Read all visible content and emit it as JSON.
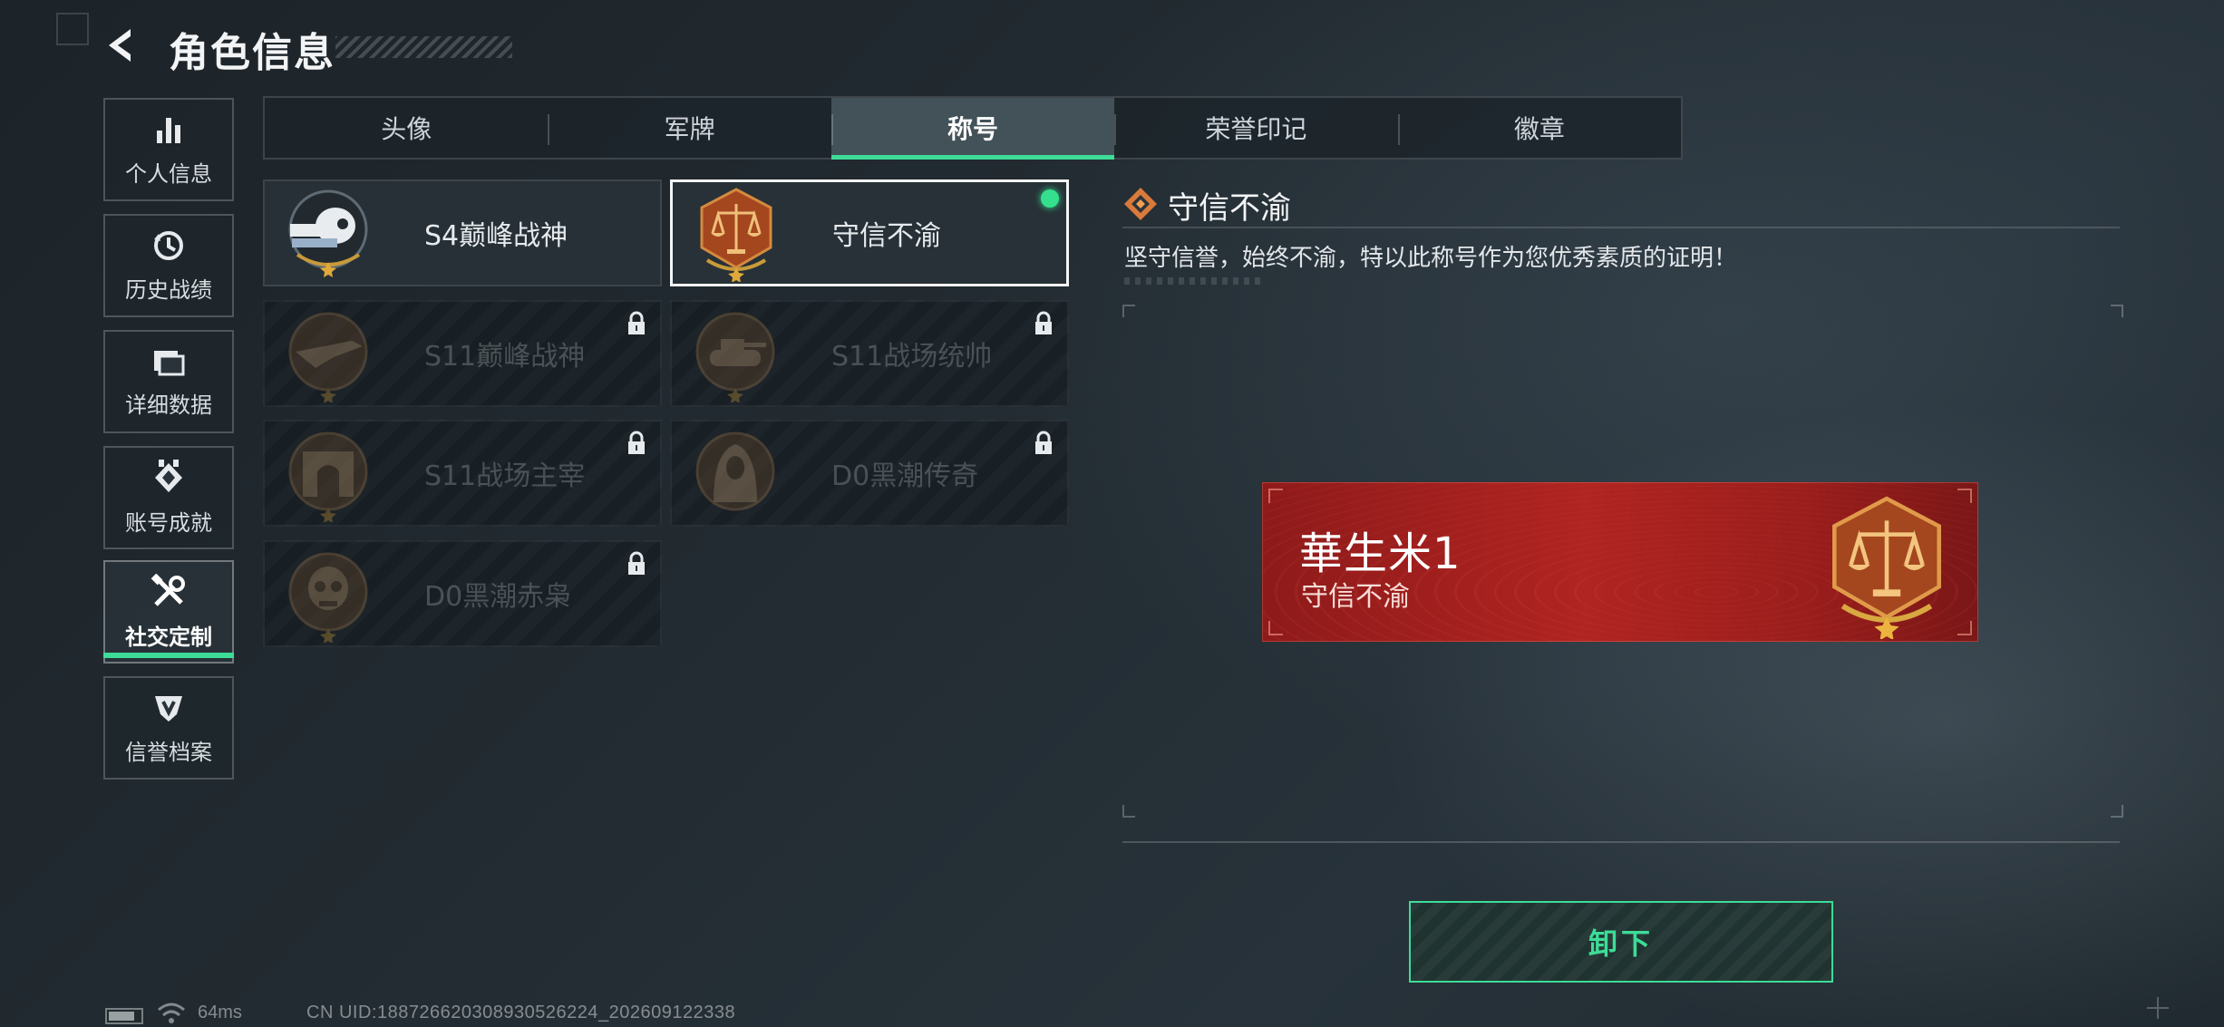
{
  "header": {
    "title": "角色信息"
  },
  "sidebar": {
    "items": [
      {
        "label": "个人信息",
        "icon": "bar-chart-icon"
      },
      {
        "label": "历史战绩",
        "icon": "history-icon"
      },
      {
        "label": "详细数据",
        "icon": "folder-icon"
      },
      {
        "label": "账号成就",
        "icon": "achievement-icon"
      },
      {
        "label": "社交定制",
        "icon": "tools-icon",
        "active": true
      },
      {
        "label": "信誉档案",
        "icon": "credibility-icon"
      }
    ]
  },
  "tabs": [
    {
      "label": "头像"
    },
    {
      "label": "军牌"
    },
    {
      "label": "称号",
      "active": true
    },
    {
      "label": "荣誉印记"
    },
    {
      "label": "徽章"
    }
  ],
  "titles": [
    {
      "name": "S4巅峰战神",
      "state": "unlocked"
    },
    {
      "name": "守信不渝",
      "state": "equipped"
    },
    {
      "name": "S11巅峰战神",
      "state": "locked"
    },
    {
      "name": "S11战场统帅",
      "state": "locked"
    },
    {
      "name": "S11战场主宰",
      "state": "locked"
    },
    {
      "name": "D0黑潮传奇",
      "state": "locked"
    },
    {
      "name": "D0黑潮赤枭",
      "state": "locked"
    }
  ],
  "detail": {
    "title": "守信不渝",
    "description": "坚守信誉，始终不渝，特以此称号作为您优秀素质的证明！"
  },
  "nameplate": {
    "player_name": "華生米1",
    "title": "守信不渝"
  },
  "actions": {
    "unequip_label": "卸下"
  },
  "footer": {
    "ping": "64ms",
    "uid": "CN UID:18872662030893052622​4_202609122338"
  },
  "colors": {
    "accent": "#3ddc97",
    "nameplate": "#b02421",
    "bronze": "#b8652f"
  }
}
